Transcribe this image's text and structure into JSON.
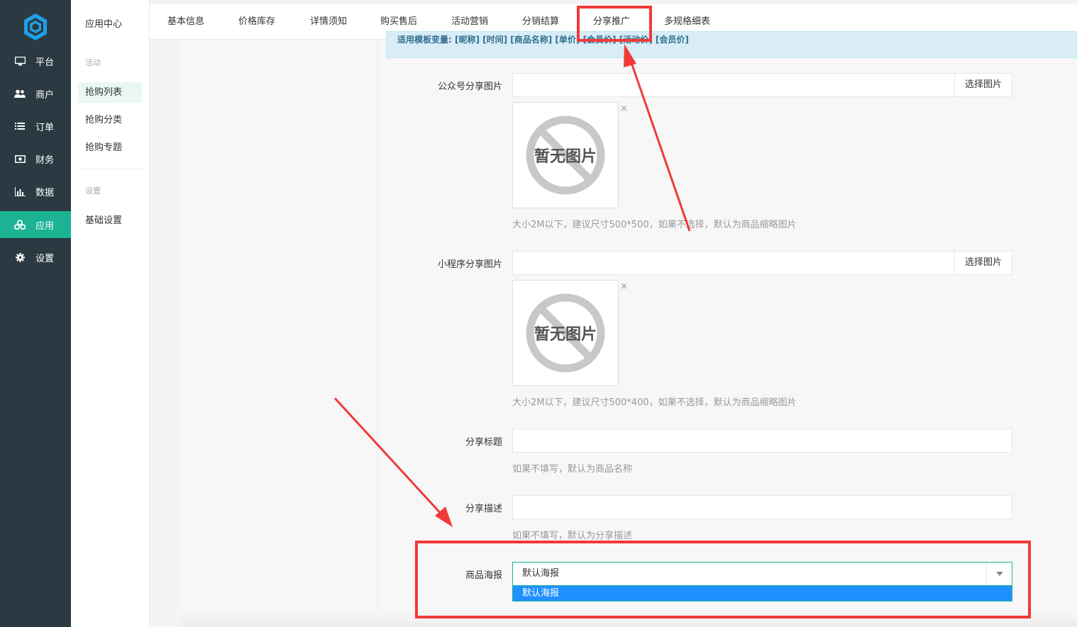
{
  "nav": {
    "items": [
      {
        "label": "平台",
        "icon": "monitor-icon"
      },
      {
        "label": "商户",
        "icon": "users-icon"
      },
      {
        "label": "订单",
        "icon": "list-icon"
      },
      {
        "label": "财务",
        "icon": "money-icon"
      },
      {
        "label": "数据",
        "icon": "bar-chart-icon"
      },
      {
        "label": "应用",
        "icon": "apps-icon",
        "active": true
      },
      {
        "label": "设置",
        "icon": "gear-icon"
      }
    ]
  },
  "sub": {
    "head": "应用中心",
    "group1": "活动",
    "links1": [
      "抢购列表",
      "抢购分类",
      "抢购专题"
    ],
    "group2": "设置",
    "links2": [
      "基础设置"
    ]
  },
  "tabs": [
    "基本信息",
    "价格库存",
    "详情须知",
    "购买售后",
    "活动营销",
    "分销结算",
    "分享推广",
    "多规格细表"
  ],
  "alert": "适用模板变量: [昵称] [时间] [商品名称] [单价] [会员价] [活动价] [会员价]",
  "form": {
    "wx_share_image": {
      "label": "公众号分享图片",
      "button": "选择图片",
      "placeholder_text": "暂无图片",
      "close": "×",
      "help": "大小2M以下，建议尺寸500*500，如果不选择，默认为商品缩略图片"
    },
    "mini_share_image": {
      "label": "小程序分享图片",
      "button": "选择图片",
      "placeholder_text": "暂无图片",
      "close": "×",
      "help": "大小2M以下，建议尺寸500*400，如果不选择，默认为商品缩略图片"
    },
    "share_title": {
      "label": "分享标题",
      "value": "",
      "help": "如果不填写，默认为商品名称"
    },
    "share_desc": {
      "label": "分享描述",
      "value": "",
      "help": "如果不填写，默认为分享描述"
    },
    "poster": {
      "label": "商品海报",
      "value": "默认海报",
      "options": [
        "默认海报"
      ]
    }
  },
  "colors": {
    "nav_bg": "#2b3a42",
    "accent": "#1bb394",
    "highlight": "#f03a3a",
    "option_selected": "#1e90ff"
  }
}
